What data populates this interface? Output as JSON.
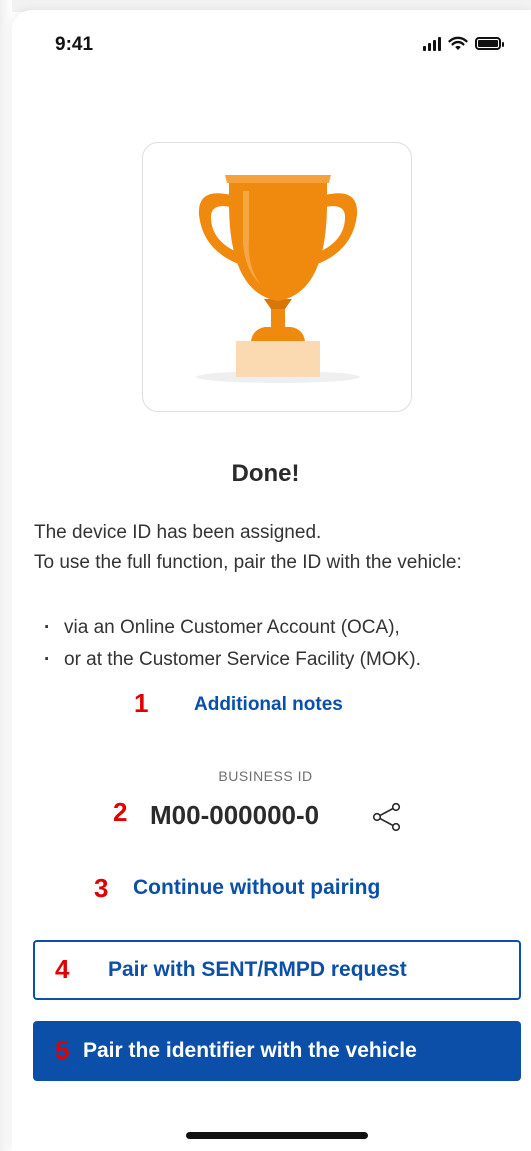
{
  "status_bar": {
    "time": "9:41",
    "icons": [
      "signal-icon",
      "wifi-icon",
      "battery-icon"
    ]
  },
  "trophy": {
    "icon": "trophy-icon",
    "colors": {
      "cup": "#f08a0e",
      "cup_dark": "#d9760a",
      "base": "#fbd9b1",
      "shadow": "#eeeeee"
    }
  },
  "title": "Done!",
  "description": {
    "line1": "The device ID has been assigned.",
    "line2": "To use the full function, pair the ID with the vehicle:",
    "bullets": [
      "via an Online Customer Account (OCA),",
      "or at the Customer Service Facility (MOK)."
    ]
  },
  "additional_notes": "Additional notes",
  "business_id": {
    "label": "BUSINESS ID",
    "value": "M00-000000-0",
    "share_icon": "share-icon"
  },
  "continue_link": "Continue without pairing",
  "buttons": {
    "pair_request": "Pair with SENT/RMPD request",
    "pair_vehicle": "Pair the identifier with the vehicle"
  },
  "markers": [
    "1",
    "2",
    "3",
    "4",
    "5"
  ],
  "colors": {
    "accent": "#0b4fa8",
    "marker": "#e00000"
  }
}
